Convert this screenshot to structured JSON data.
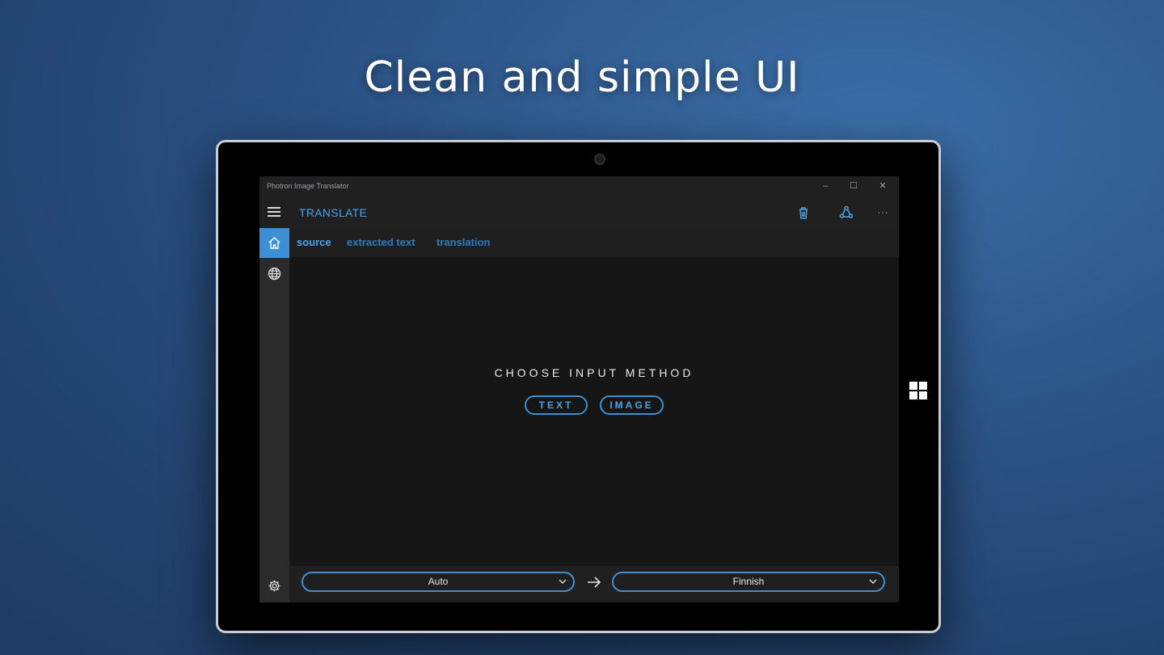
{
  "headline": "Clean and simple UI",
  "app": {
    "window_title": "Photron Image Translator",
    "window_controls": {
      "minimize": "–",
      "maximize": "☐",
      "close": "✕"
    },
    "header": {
      "page_label": "TRANSLATE",
      "icons": [
        "menu-icon",
        "trash-icon",
        "share-icon",
        "more-icon"
      ],
      "more_label": "···"
    },
    "nav": {
      "items": [
        "home-icon",
        "globe-icon"
      ],
      "footer": "settings-icon"
    },
    "tabs": [
      {
        "label": "source",
        "active": true
      },
      {
        "label": "extracted text",
        "active": false
      },
      {
        "label": "translation",
        "active": false
      }
    ],
    "main": {
      "prompt": "CHOOSE INPUT METHOD",
      "text_button": "TEXT",
      "image_button": "IMAGE"
    },
    "languages": {
      "source": "Auto",
      "target": "Finnish"
    }
  },
  "colors": {
    "accent": "#3a8fd6",
    "background": "#2c5487",
    "app_bg": "#1f1f1f"
  }
}
